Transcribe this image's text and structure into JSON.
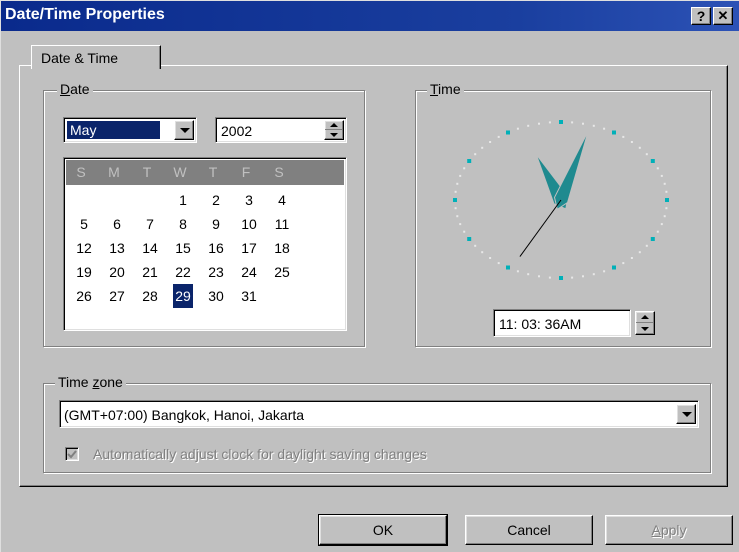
{
  "window": {
    "title": "Date/Time Properties",
    "help_label": "?",
    "close_label": "✕"
  },
  "tabs": [
    {
      "label": "Date & Time",
      "selected": true
    }
  ],
  "date_group": {
    "label_first": "D",
    "label_rest": "ate",
    "month": {
      "selected": "May"
    },
    "year": {
      "value": "2002"
    },
    "calendar": {
      "weekdays": [
        "S",
        "M",
        "T",
        "W",
        "T",
        "F",
        "S"
      ],
      "days": [
        "1",
        "2",
        "3",
        "4",
        "5",
        "6",
        "7",
        "8",
        "9",
        "10",
        "11",
        "12",
        "13",
        "14",
        "15",
        "16",
        "17",
        "18",
        "19",
        "20",
        "21",
        "22",
        "23",
        "24",
        "25",
        "26",
        "27",
        "28",
        "29",
        "30",
        "31"
      ],
      "selected_day": "29"
    }
  },
  "time_group": {
    "label_first": "T",
    "label_rest": "ime",
    "time_value": "11: 03: 36AM",
    "clock": {
      "hour": 11,
      "minute": 3,
      "second": 36
    }
  },
  "timezone_group": {
    "label_pre": "Time ",
    "label_u": "z",
    "label_post": "one",
    "selected": "(GMT+07:00) Bangkok, Hanoi, Jakarta",
    "auto_dst": {
      "checked": true,
      "enabled": false,
      "label": "Automatically adjust clock for daylight saving changes"
    }
  },
  "buttons": {
    "ok": "OK",
    "cancel": "Cancel",
    "apply_first": "A",
    "apply_rest": "pply"
  },
  "colors": {
    "titlebar": "#0a2a8c",
    "selection": "#0a246a",
    "clock_hands": "#1f8a8f",
    "clock_marks": "#00b0b8"
  }
}
